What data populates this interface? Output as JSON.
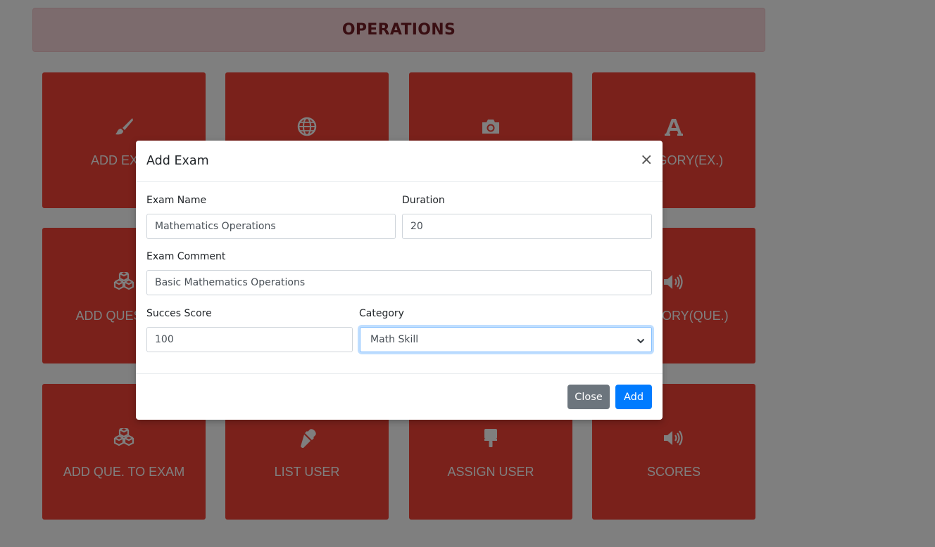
{
  "header": {
    "title": "OPERATIONS"
  },
  "tiles": [
    {
      "label": "ADD EXAM",
      "icon": "paintbrush-icon"
    },
    {
      "label": "",
      "icon": "globe-icon"
    },
    {
      "label": "",
      "icon": "camera-icon"
    },
    {
      "label": "CATEGORY(EX.)",
      "icon": "font-icon"
    },
    {
      "label": "ADD QUESTION",
      "icon": "cubes-icon"
    },
    {
      "label": "",
      "icon": ""
    },
    {
      "label": "",
      "icon": ""
    },
    {
      "label": "CATEGORY(QUE.)",
      "icon": "volume-icon"
    },
    {
      "label": "ADD QUE. TO EXAM",
      "icon": "cubes-icon"
    },
    {
      "label": "LIST USER",
      "icon": "eyedropper-icon"
    },
    {
      "label": "ASSIGN USER",
      "icon": "paint-roller-icon"
    },
    {
      "label": "SCORES",
      "icon": "volume-icon"
    }
  ],
  "modal": {
    "title": "Add Exam",
    "close_symbol": "×",
    "exam_name": {
      "label": "Exam Name",
      "value": "Mathematics Operations"
    },
    "duration": {
      "label": "Duration",
      "value": "20"
    },
    "exam_comment": {
      "label": "Exam Comment",
      "value": "Basic Mathematics Operations"
    },
    "success_score": {
      "label": "Succes Score",
      "value": "100"
    },
    "category": {
      "label": "Category",
      "value": "Math Skill"
    },
    "close_button": "Close",
    "add_button": "Add"
  },
  "colors": {
    "tile": "#f44336",
    "header_bg": "#f8d7da",
    "header_text": "#721c24",
    "primary": "#007bff",
    "secondary": "#6c757d"
  }
}
